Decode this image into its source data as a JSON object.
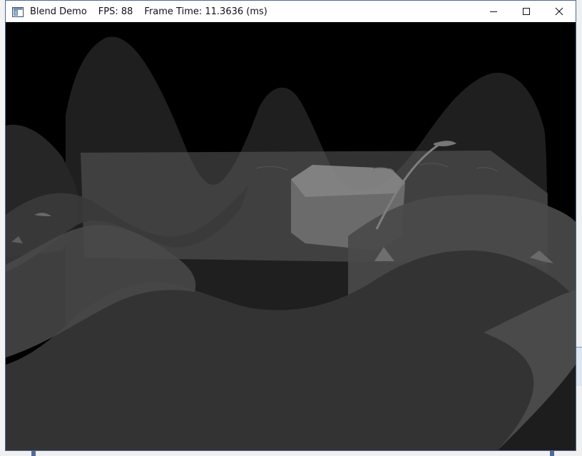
{
  "window": {
    "title": "Blend Demo",
    "fps_label": "FPS: 88",
    "frame_time_label": "Frame Time: 11.3636 (ms)",
    "icons": {
      "app": "app-window-icon",
      "minimize": "minimize-icon",
      "maximize": "maximize-icon",
      "close": "close-icon"
    }
  },
  "scene": {
    "description_colors": {
      "sky": "#000000",
      "ground": "#333333",
      "hills": "#2b2b2b",
      "translucent_box": "#8a8a8a",
      "water": "#5a5a5a"
    }
  }
}
